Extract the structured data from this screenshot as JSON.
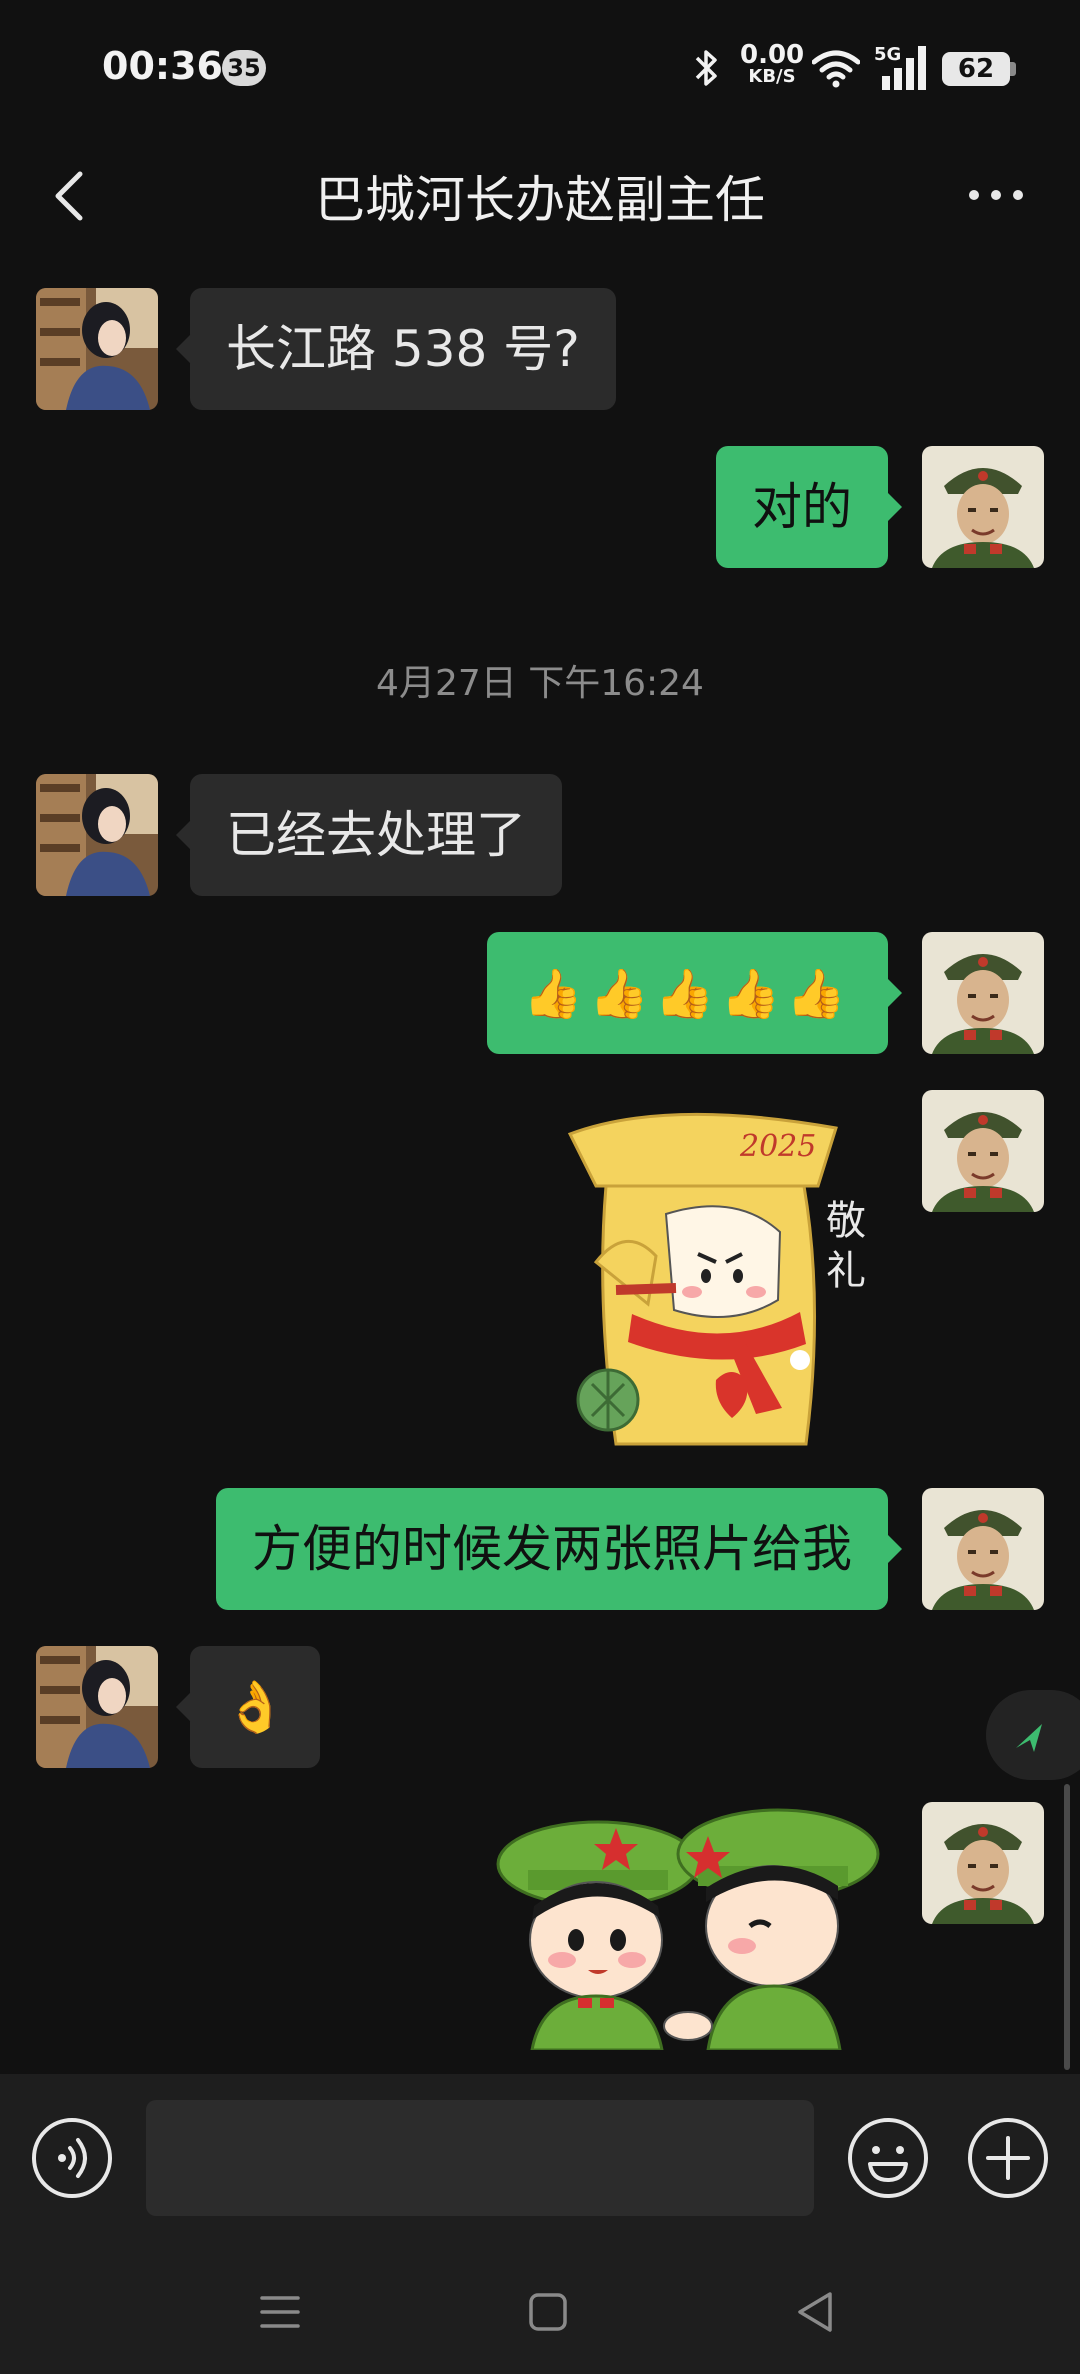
{
  "status_bar": {
    "time": "00:36",
    "notification_count": "35",
    "net_speed_value": "0.00",
    "net_speed_unit": "KB/S",
    "network_type": "5G",
    "battery_level": "62"
  },
  "header": {
    "title": "巴城河长办赵副主任"
  },
  "messages": [
    {
      "side": "in",
      "text": "长江路 538 号?"
    },
    {
      "side": "out",
      "text": "对的"
    },
    {
      "side": "in",
      "text": "已经去处理了"
    },
    {
      "side": "out",
      "text": "👍👍👍👍👍"
    },
    {
      "side": "out",
      "sticker": "salute-sticker",
      "sticker_text": "敬礼",
      "sticker_year": "2025"
    },
    {
      "side": "out",
      "text": "方便的时候发两张照片给我"
    },
    {
      "side": "in",
      "text": "👌"
    },
    {
      "side": "out",
      "sticker": "soldiers-handshake-sticker"
    }
  ],
  "timestamp": "4月27日 下午16:24",
  "input": {
    "value": ""
  },
  "colors": {
    "background": "#111111",
    "incoming_bubble": "#2b2b2b",
    "outgoing_bubble": "#3dbc6f",
    "accent": "#3dbc6f"
  },
  "icons": {
    "back": "chevron-left-icon",
    "more": "more-horizontal-icon",
    "voice": "voice-icon",
    "emoji": "emoji-icon",
    "plus": "plus-icon",
    "jump": "navigation-arrow-icon"
  }
}
